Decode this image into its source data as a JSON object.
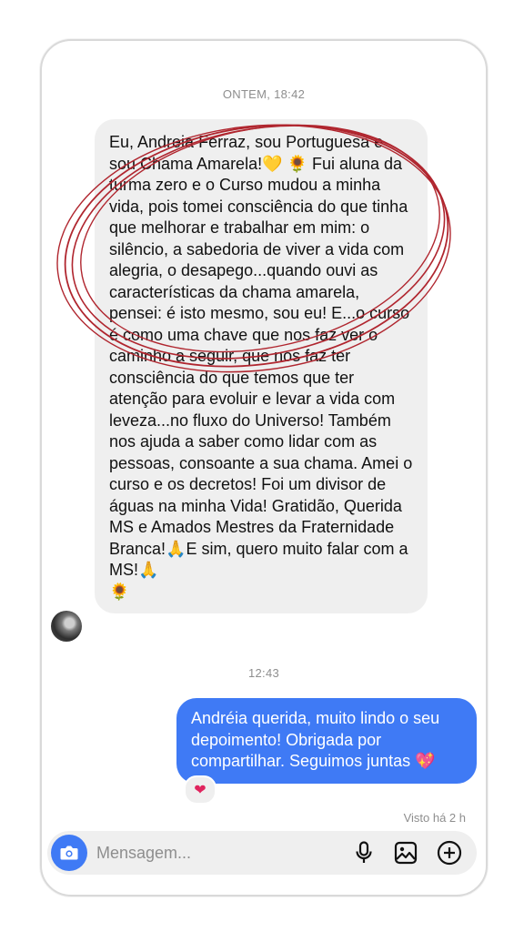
{
  "timestamps": {
    "first": "ONTEM, 18:42",
    "second": "12:43"
  },
  "incoming_message": {
    "text_before_heart": "Eu, Andreia Ferraz, sou Portuguesa e sou Chama Amarela!",
    "heart_emoji": "💛",
    "sunflower_emoji": "🌻",
    "body": " Fui aluna da turma zero e o Curso mudou a minha vida, pois tomei consciência do que tinha que melhorar e trabalhar em mim: o silêncio, a sabedoria de viver a vida com alegria,  o desapego...quando ouvi as características da chama amarela, pensei: é isto mesmo,  sou eu! E...o curso é como uma chave que nos faz ver o caminho a seguir,  que nos faz ter consciência do que temos   que ter atenção para evoluir e levar a vida com leveza...no fluxo do Universo! Também nos ajuda a saber como lidar com as pessoas, consoante a sua chama. Amei o curso e os decretos! Foi um divisor de águas na minha Vida! Gratidão, Querida MS e Amados Mestres da Fraternidade Branca!",
    "pray_emoji": "🙏",
    "tail": "E sim, quero muito falar com a MS!",
    "final_emoji": "🌻"
  },
  "outgoing_message": {
    "text": "Andréia querida, muito lindo o seu depoimento! Obrigada por compartilhar. Seguimos juntas",
    "emoji": "💖",
    "reaction": "❤"
  },
  "seen_status": "Visto há 2 h",
  "composer": {
    "placeholder": "Mensagem...",
    "icons": [
      "camera-icon",
      "microphone-icon",
      "gallery-icon",
      "plus-icon"
    ]
  },
  "colors": {
    "accent_blue": "#3f7af5",
    "bubble_gray": "#efefef",
    "annotation_red": "#b0262f"
  }
}
